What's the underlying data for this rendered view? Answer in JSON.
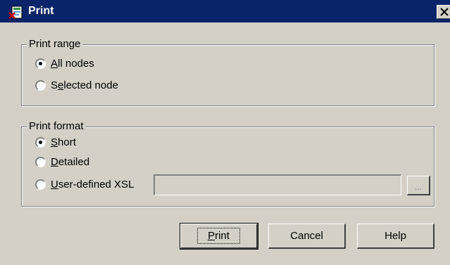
{
  "window": {
    "title": "Print",
    "app_icon": "print-doc-icon",
    "close_icon": "close-icon"
  },
  "print_range": {
    "legend": "Print range",
    "options": [
      {
        "pre": "",
        "u": "A",
        "post": "ll nodes",
        "checked": true
      },
      {
        "pre": "S",
        "u": "e",
        "post": "lected node",
        "checked": false
      }
    ]
  },
  "print_format": {
    "legend": "Print format",
    "options": [
      {
        "pre": "",
        "u": "S",
        "post": "hort",
        "checked": true
      },
      {
        "pre": "",
        "u": "D",
        "post": "etailed",
        "checked": false
      },
      {
        "pre": "",
        "u": "U",
        "post": "ser-defined XSL",
        "checked": false
      }
    ],
    "xsl_value": "",
    "browse_label": "..."
  },
  "buttons": {
    "print": {
      "pre": "",
      "u": "P",
      "post": "rint"
    },
    "cancel": "Cancel",
    "help": "Help"
  },
  "colors": {
    "titlebar": "#0a246a",
    "face": "#d4d0c8"
  }
}
